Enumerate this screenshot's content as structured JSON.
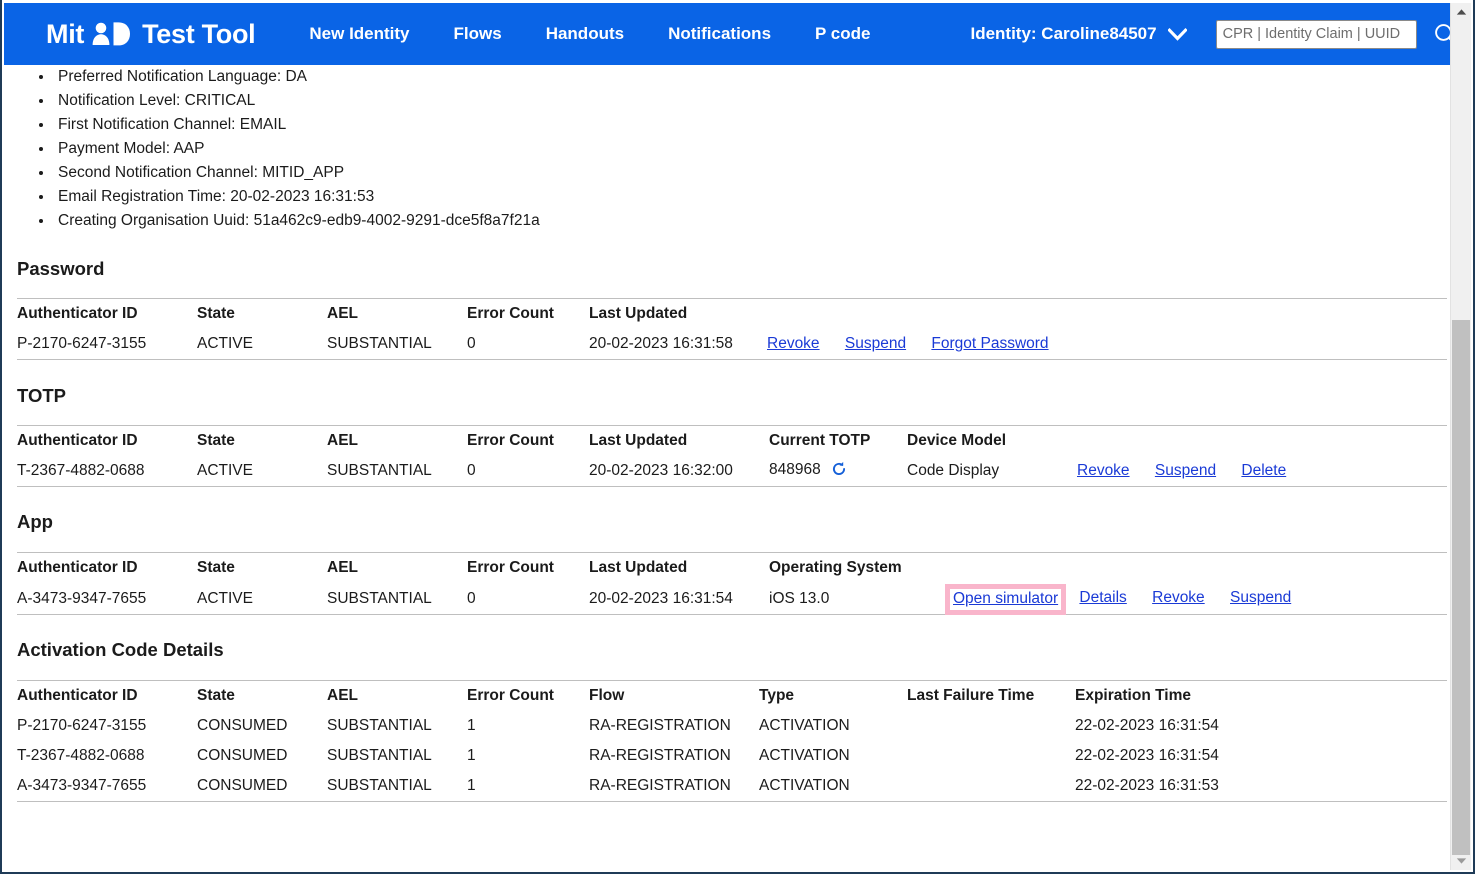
{
  "window": {
    "scrollbar": {
      "up_arrow_icon": "triangle-up-icon",
      "down_arrow_icon": "triangle-down-icon"
    }
  },
  "header": {
    "brand": {
      "text_before": "Mit",
      "glyph_icon": "mitid-person-d-logo",
      "text_after": "Test Tool"
    },
    "nav": [
      {
        "label": "New Identity"
      },
      {
        "label": "Flows"
      },
      {
        "label": "Handouts"
      },
      {
        "label": "Notifications"
      },
      {
        "label": "P code"
      }
    ],
    "identity": {
      "label": "Identity: Caroline84507",
      "caret_icon": "chevron-down-icon"
    },
    "search": {
      "value": "",
      "placeholder": "CPR | Identity Claim | UUID",
      "icon": "search-icon"
    },
    "background_color": "#0a64e6"
  },
  "main": {
    "identity_attributes": [
      "Preferred Notification Language: DA",
      "Notification Level: CRITICAL",
      "First Notification Channel: EMAIL",
      "Payment Model: AAP",
      "Second Notification Channel: MITID_APP",
      "Email Registration Time: 20-02-2023 16:31:53",
      "Creating Organisation Uuid: 51a462c9-edb9-4002-9291-dce5f8a7f21a"
    ],
    "sections": {
      "password": {
        "title": "Password",
        "columns": [
          "Authenticator ID",
          "State",
          "AEL",
          "Error Count",
          "Last Updated"
        ],
        "rows": [
          {
            "authenticator_id": "P-2170-6247-3155",
            "state": "ACTIVE",
            "ael": "SUBSTANTIAL",
            "error_count": "0",
            "last_updated": "20-02-2023 16:31:58",
            "actions": [
              "Revoke",
              "Suspend",
              "Forgot Password"
            ]
          }
        ]
      },
      "totp": {
        "title": "TOTP",
        "columns": [
          "Authenticator ID",
          "State",
          "AEL",
          "Error Count",
          "Last Updated",
          "Current TOTP",
          "Device Model"
        ],
        "rows": [
          {
            "authenticator_id": "T-2367-4882-0688",
            "state": "ACTIVE",
            "ael": "SUBSTANTIAL",
            "error_count": "0",
            "last_updated": "20-02-2023 16:32:00",
            "current_totp": "848968",
            "refresh_icon": "refresh-icon",
            "device_model": "Code Display",
            "actions": [
              "Revoke",
              "Suspend",
              "Delete"
            ]
          }
        ]
      },
      "app": {
        "title": "App",
        "columns": [
          "Authenticator ID",
          "State",
          "AEL",
          "Error Count",
          "Last Updated",
          "Operating System"
        ],
        "rows": [
          {
            "authenticator_id": "A-3473-9347-7655",
            "state": "ACTIVE",
            "ael": "SUBSTANTIAL",
            "error_count": "0",
            "last_updated": "20-02-2023 16:31:54",
            "operating_system": "iOS 13.0",
            "highlighted_action": "Open simulator",
            "highlight_color": "#f9b5cb",
            "actions": [
              "Details",
              "Revoke",
              "Suspend"
            ]
          }
        ]
      },
      "activation_code_details": {
        "title": "Activation Code Details",
        "columns": [
          "Authenticator ID",
          "State",
          "AEL",
          "Error Count",
          "Flow",
          "Type",
          "Last Failure Time",
          "Expiration Time"
        ],
        "rows": [
          {
            "authenticator_id": "P-2170-6247-3155",
            "state": "CONSUMED",
            "ael": "SUBSTANTIAL",
            "error_count": "1",
            "flow": "RA-REGISTRATION",
            "type": "ACTIVATION",
            "last_failure_time": "",
            "expiration_time": "22-02-2023 16:31:54"
          },
          {
            "authenticator_id": "T-2367-4882-0688",
            "state": "CONSUMED",
            "ael": "SUBSTANTIAL",
            "error_count": "1",
            "flow": "RA-REGISTRATION",
            "type": "ACTIVATION",
            "last_failure_time": "",
            "expiration_time": "22-02-2023 16:31:54"
          },
          {
            "authenticator_id": "A-3473-9347-7655",
            "state": "CONSUMED",
            "ael": "SUBSTANTIAL",
            "error_count": "1",
            "flow": "RA-REGISTRATION",
            "type": "ACTIVATION",
            "last_failure_time": "",
            "expiration_time": "22-02-2023 16:31:53"
          }
        ]
      }
    }
  }
}
